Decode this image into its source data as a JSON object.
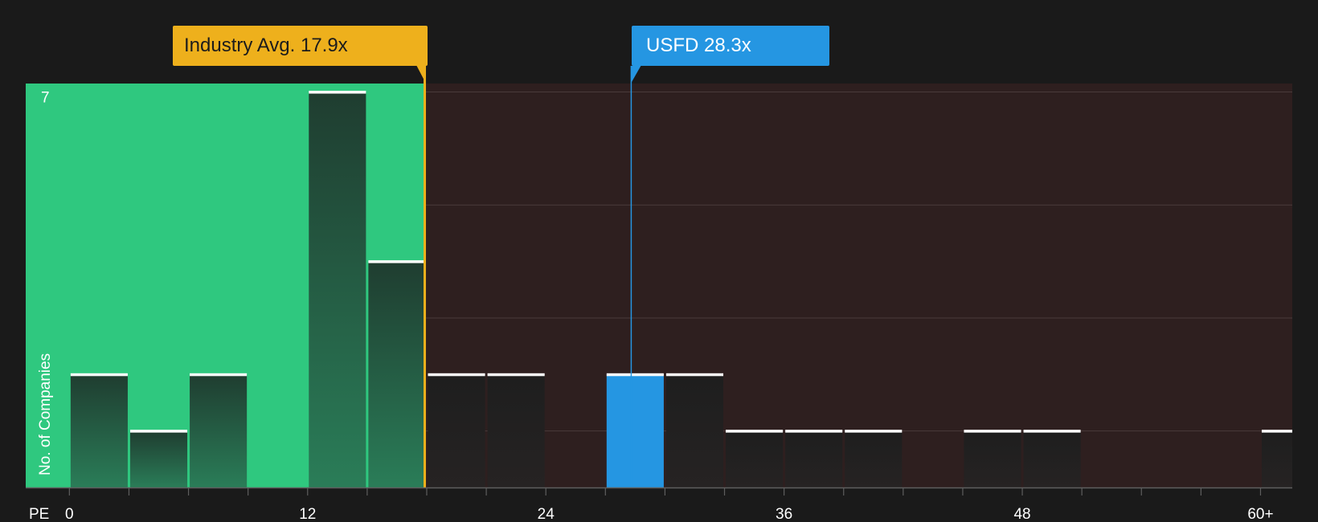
{
  "chart_data": {
    "type": "bar",
    "xlabel": "PE",
    "ylabel": "No. of Companies",
    "x_tick_labels": [
      "0",
      "12",
      "24",
      "36",
      "48",
      "60+"
    ],
    "x_ticks": [
      0,
      12,
      24,
      36,
      48,
      60
    ],
    "xlim": [
      -2.2,
      61.6
    ],
    "y_tick_labels": [
      "7"
    ],
    "ylim": [
      0,
      7.15
    ],
    "bin_width": 3,
    "bins": [
      {
        "start": 0,
        "end": 3,
        "count": 2
      },
      {
        "start": 3,
        "end": 6,
        "count": 1
      },
      {
        "start": 6,
        "end": 9,
        "count": 2
      },
      {
        "start": 9,
        "end": 12,
        "count": 0
      },
      {
        "start": 12,
        "end": 15,
        "count": 7
      },
      {
        "start": 15,
        "end": 18,
        "count": 4
      },
      {
        "start": 18,
        "end": 21,
        "count": 2
      },
      {
        "start": 21,
        "end": 24,
        "count": 2
      },
      {
        "start": 24,
        "end": 27,
        "count": 0
      },
      {
        "start": 27,
        "end": 30,
        "count": 2,
        "highlight": true
      },
      {
        "start": 30,
        "end": 33,
        "count": 2
      },
      {
        "start": 33,
        "end": 36,
        "count": 1
      },
      {
        "start": 36,
        "end": 39,
        "count": 1
      },
      {
        "start": 39,
        "end": 42,
        "count": 1
      },
      {
        "start": 42,
        "end": 45,
        "count": 0
      },
      {
        "start": 45,
        "end": 48,
        "count": 1
      },
      {
        "start": 48,
        "end": 51,
        "count": 1
      },
      {
        "start": 51,
        "end": 54,
        "count": 0
      },
      {
        "start": 54,
        "end": 57,
        "count": 0
      },
      {
        "start": 57,
        "end": 60,
        "count": 0
      },
      {
        "start": 60,
        "end": 63,
        "count": 1
      }
    ],
    "industry_avg": {
      "value": 17.9,
      "label": "Industry Avg. 17.9x"
    },
    "company": {
      "ticker": "USFD",
      "value": 28.3,
      "label": "USFD 28.3x"
    },
    "colors": {
      "background": "#1a1a1a",
      "below_avg_zone": "#2fc87f",
      "above_avg_zone": "#2e1f1f",
      "industry_avg": "#eeb01c",
      "company": "#2596e2",
      "bar_top": "#ffffff"
    },
    "grid": true
  }
}
